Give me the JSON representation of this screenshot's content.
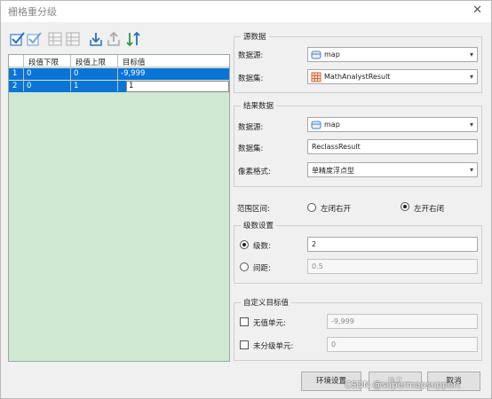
{
  "window": {
    "title": "栅格重分级",
    "close_glyph": "✕"
  },
  "toolbar": {
    "icons": [
      "select-all-icon",
      "select-invert-icon",
      "insert-row-icon",
      "delete-row-icon",
      "import-icon",
      "export-icon",
      "reverse-icon"
    ]
  },
  "table": {
    "headers": [
      "段值下限",
      "段值上限",
      "目标值"
    ],
    "rows": [
      {
        "index": "1",
        "lower": "0",
        "upper": "0",
        "target": "-9,999"
      },
      {
        "index": "2",
        "lower": "0",
        "upper": "1",
        "target": "1"
      }
    ]
  },
  "source": {
    "title": "源数据",
    "datasource_label": "数据源:",
    "datasource_value": "map",
    "dataset_label": "数据集:",
    "dataset_value": "MathAnalystResult"
  },
  "result": {
    "title": "结果数据",
    "datasource_label": "数据源:",
    "datasource_value": "map",
    "dataset_label": "数据集:",
    "dataset_value": "ReclassResult",
    "pixel_label": "像素格式:",
    "pixel_value": "单精度浮点型"
  },
  "range": {
    "label": "范围区间:",
    "option_left": "左闭右开",
    "option_right": "左开右闭"
  },
  "levels": {
    "title": "级数设置",
    "count_label": "级数:",
    "count_value": "2",
    "interval_label": "间距:",
    "interval_value": "0.5"
  },
  "custom": {
    "title": "自定义目标值",
    "nodata_label": "无值单元:",
    "nodata_value": "-9,999",
    "unclassified_label": "未分级单元:",
    "unclassified_value": "0"
  },
  "buttons": {
    "env": "环境设置",
    "ok": "确定",
    "cancel": "取消"
  },
  "watermark": "CSDN @supermapsupport",
  "colors": {
    "selection": "#0a75d6",
    "table_bg": "#cfe8d2",
    "dialog_bg": "#f0f0f0"
  }
}
